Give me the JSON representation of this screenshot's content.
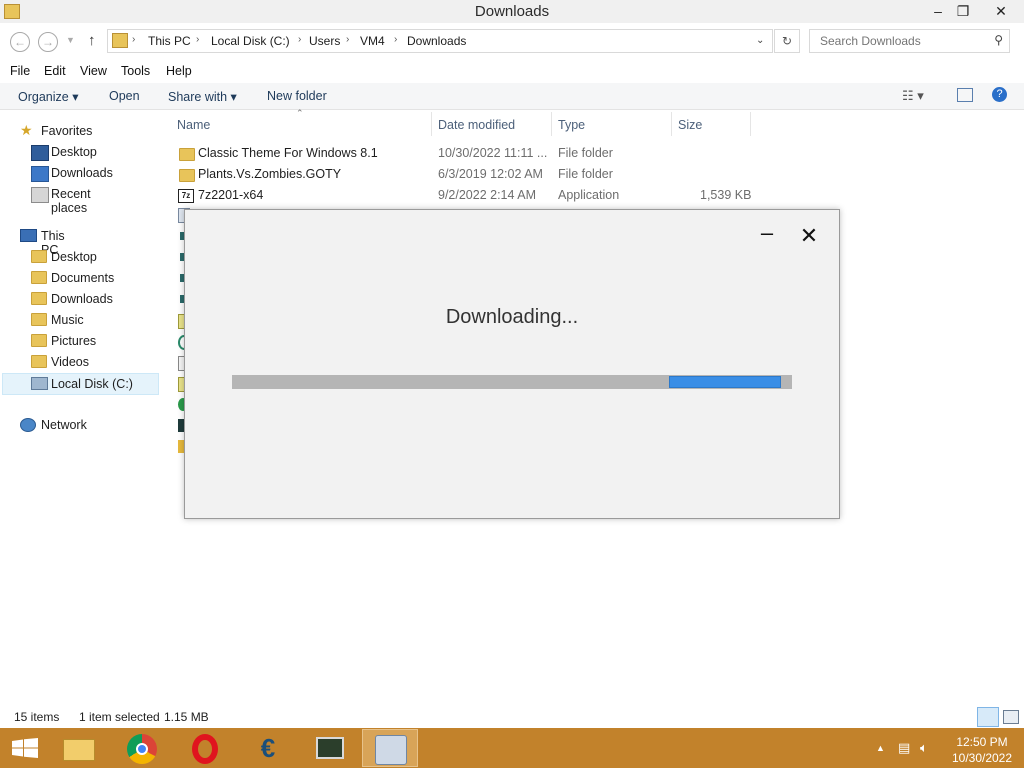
{
  "window": {
    "title": "Downloads",
    "minimize": "–",
    "maximize": "❐",
    "close": "✕"
  },
  "address": {
    "crumbs": [
      "This PC",
      "Local Disk (C:)",
      "Users",
      "VM4",
      "Downloads"
    ],
    "search_placeholder": "Search Downloads"
  },
  "menu": [
    "File",
    "Edit",
    "View",
    "Tools",
    "Help"
  ],
  "commands": {
    "organize": "Organize ▾",
    "open": "Open",
    "share_with": "Share with ▾",
    "new_folder": "New folder"
  },
  "nav": {
    "favorites": "Favorites",
    "fav_items": [
      "Desktop",
      "Downloads",
      "Recent places"
    ],
    "this_pc": "This PC",
    "pc_items": [
      "Desktop",
      "Documents",
      "Downloads",
      "Music",
      "Pictures",
      "Videos",
      "Local Disk (C:)"
    ],
    "network": "Network"
  },
  "columns": {
    "name": "Name",
    "date_modified": "Date modified",
    "type": "Type",
    "size": "Size"
  },
  "files": [
    {
      "name": "Classic Theme For Windows 8.1",
      "date": "10/30/2022 11:11 ...",
      "type": "File folder",
      "size": ""
    },
    {
      "name": "Plants.Vs.Zombies.GOTY",
      "date": "6/3/2019 12:02 AM",
      "type": "File folder",
      "size": ""
    },
    {
      "name": "7z2201-x64",
      "date": "9/2/2022 2:14 AM",
      "type": "Application",
      "size": "1,539 KB"
    }
  ],
  "dialog": {
    "status": "Downloading...",
    "minimize": "–",
    "close": "✕",
    "progress": 0.78
  },
  "statusbar": {
    "items": "15 items",
    "selected": "1 item selected",
    "size": "1.15 MB"
  },
  "taskbar": {
    "time": "12:50 PM",
    "date": "10/30/2022"
  },
  "colors": {
    "taskbar": "#c2822b",
    "progress": "#3a8ee6",
    "folder": "#e8c45a"
  }
}
